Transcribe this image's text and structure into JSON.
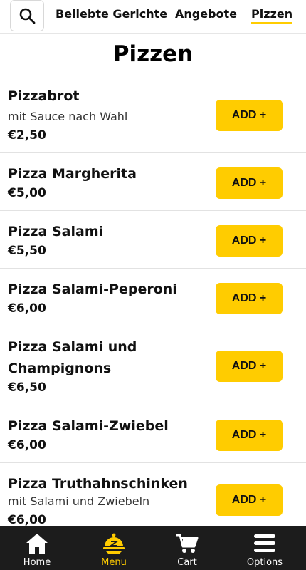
{
  "header": {
    "tabs": [
      {
        "label": "Beliebte Gerichte"
      },
      {
        "label": "Angebote"
      },
      {
        "label": "Pizzen"
      }
    ]
  },
  "page": {
    "title": "Pizzen"
  },
  "items": [
    {
      "name": "Pizzabrot",
      "description": "mit Sauce nach Wahl",
      "price": "€2,50",
      "button": "ADD +"
    },
    {
      "name": "Pizza Margherita",
      "description": "",
      "price": "€5,00",
      "button": "ADD +"
    },
    {
      "name": "Pizza Salami",
      "description": "",
      "price": "€5,50",
      "button": "ADD +"
    },
    {
      "name": "Pizza Salami-Peperoni",
      "description": "",
      "price": "€6,00",
      "button": "ADD +"
    },
    {
      "name": "Pizza Salami und Champignons",
      "description": "",
      "price": "€6,50",
      "button": "ADD +"
    },
    {
      "name": "Pizza Salami-Zwiebel",
      "description": "",
      "price": "€6,00",
      "button": "ADD +"
    },
    {
      "name": "Pizza Truthahnschinken",
      "description": "mit Salami und Zwiebeln",
      "price": "€6,00",
      "button": "ADD +"
    }
  ],
  "bottom_nav": [
    {
      "label": "Home",
      "icon": "home-icon"
    },
    {
      "label": "Menu",
      "icon": "menu-cloche-icon"
    },
    {
      "label": "Cart",
      "icon": "cart-icon"
    },
    {
      "label": "Options",
      "icon": "options-icon"
    }
  ],
  "colors": {
    "accent": "#ffcc00",
    "nav_bg": "#1c1c1c"
  }
}
